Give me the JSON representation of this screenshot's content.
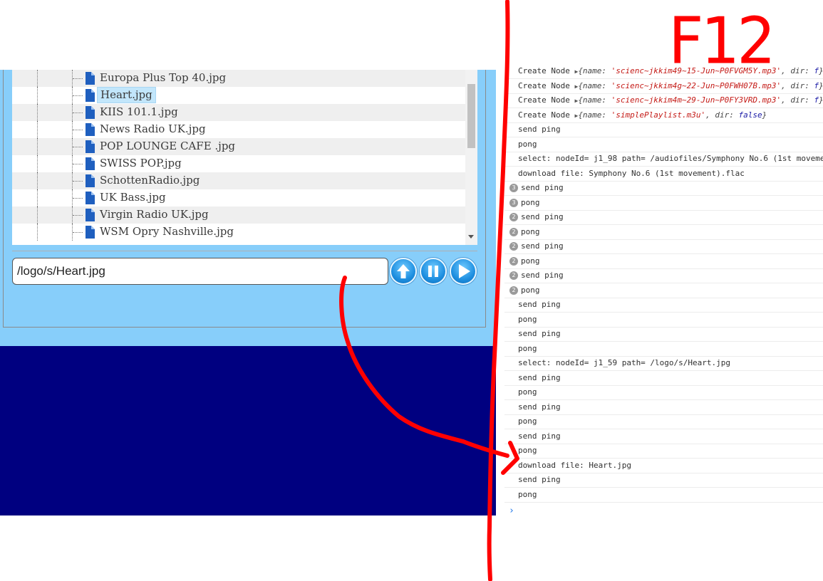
{
  "file_tree": {
    "items": [
      {
        "label": "Europa Plus Top 40.jpg",
        "selected": false
      },
      {
        "label": "Heart.jpg",
        "selected": true
      },
      {
        "label": "KIIS 101.1.jpg",
        "selected": false
      },
      {
        "label": "News Radio UK.jpg",
        "selected": false
      },
      {
        "label": "POP LOUNGE CAFE .jpg",
        "selected": false
      },
      {
        "label": "SWISS POP.jpg",
        "selected": false
      },
      {
        "label": "SchottenRadio.jpg",
        "selected": false
      },
      {
        "label": "UK Bass.jpg",
        "selected": false
      },
      {
        "label": "Virgin Radio UK.jpg",
        "selected": false
      },
      {
        "label": "WSM Opry Nashville.jpg",
        "selected": false
      }
    ]
  },
  "path_input": {
    "value": "/logo/s/Heart.jpg"
  },
  "controls": {
    "upload_icon": "arrow-up-icon",
    "pause_icon": "pause-icon",
    "play_icon": "play-icon"
  },
  "colors": {
    "panel": "#87cefa",
    "navy": "#000080",
    "annotation": "#ff0000",
    "selected_row": "#c2e6fb"
  },
  "console": {
    "logs": [
      {
        "badge": "",
        "text": "Create Node ",
        "obj_name": "'scienc~jkkim49~15-Jun~P0FVGM5Y.mp3'",
        "obj_dir": "f"
      },
      {
        "badge": "",
        "text": "Create Node ",
        "obj_name": "'scienc~jkkim4g~22-Jun~P0FWH07B.mp3'",
        "obj_dir": "f"
      },
      {
        "badge": "",
        "text": "Create Node ",
        "obj_name": "'scienc~jkkim4m~29-Jun~P0FY3VRD.mp3'",
        "obj_dir": "f"
      },
      {
        "badge": "",
        "text": "Create Node ",
        "obj_name": "'simplePlaylist.m3u'",
        "obj_dir": "false"
      },
      {
        "badge": "",
        "text": "send ping"
      },
      {
        "badge": "",
        "text": "pong"
      },
      {
        "badge": "",
        "text": "select: nodeId= j1_98 path= /audiofiles/Symphony No.6 (1st moveme"
      },
      {
        "badge": "",
        "text": "download file:  Symphony No.6 (1st movement).flac"
      },
      {
        "badge": "3",
        "text": "send ping"
      },
      {
        "badge": "3",
        "text": "pong"
      },
      {
        "badge": "2",
        "text": "send ping"
      },
      {
        "badge": "2",
        "text": "pong"
      },
      {
        "badge": "2",
        "text": "send ping"
      },
      {
        "badge": "2",
        "text": "pong"
      },
      {
        "badge": "2",
        "text": "send ping"
      },
      {
        "badge": "2",
        "text": "pong"
      },
      {
        "badge": "",
        "text": "send ping"
      },
      {
        "badge": "",
        "text": "pong"
      },
      {
        "badge": "",
        "text": "send ping"
      },
      {
        "badge": "",
        "text": "pong"
      },
      {
        "badge": "",
        "text": "select: nodeId= j1_59 path= /logo/s/Heart.jpg"
      },
      {
        "badge": "",
        "text": "send ping"
      },
      {
        "badge": "",
        "text": "pong"
      },
      {
        "badge": "",
        "text": "send ping"
      },
      {
        "badge": "",
        "text": "pong"
      },
      {
        "badge": "",
        "text": "send ping"
      },
      {
        "badge": "",
        "text": "pong"
      },
      {
        "badge": "",
        "text": "download file:  Heart.jpg"
      },
      {
        "badge": "",
        "text": "send ping"
      },
      {
        "badge": "",
        "text": "pong"
      }
    ],
    "prompt": "›"
  },
  "annotation": {
    "label": "F12"
  }
}
